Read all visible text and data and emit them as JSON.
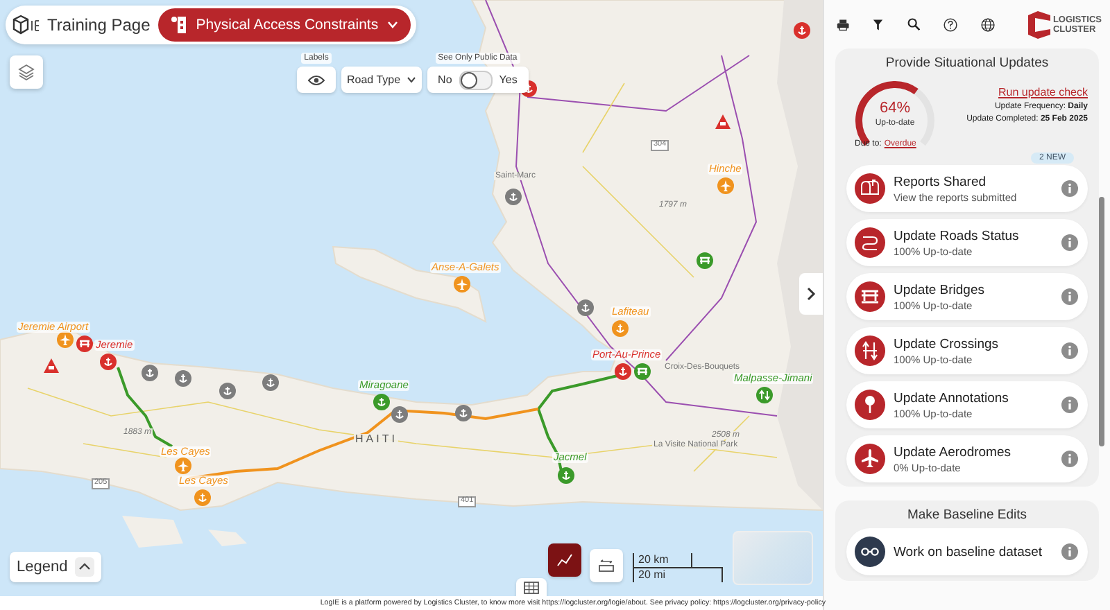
{
  "header": {
    "page_title": "Training Page",
    "layer_button": "Physical Access Constraints"
  },
  "map_controls": {
    "labels_caption": "Labels",
    "road_type": "Road Type",
    "public_data": {
      "caption": "See Only Public Data",
      "off_label": "No",
      "on_label": "Yes",
      "on": false
    }
  },
  "map_labels": [
    {
      "text": "HAITI",
      "kind": "country"
    },
    {
      "text": "Saint-Marc",
      "kind": "place"
    },
    {
      "text": "Croix-Des-Bouquets",
      "kind": "place"
    },
    {
      "text": "La Visite National Park",
      "kind": "place"
    },
    {
      "text": "1883 m",
      "kind": "elevation"
    },
    {
      "text": "1797 m",
      "kind": "elevation"
    },
    {
      "text": "2508 m",
      "kind": "elevation"
    },
    {
      "text": "401",
      "kind": "road"
    },
    {
      "text": "205",
      "kind": "road"
    },
    {
      "text": "304",
      "kind": "road"
    }
  ],
  "markers": [
    {
      "label": "Jeremie Airport",
      "kind": "airport",
      "color": "#f0931e"
    },
    {
      "kind": "bridge",
      "color": "#d9302c"
    },
    {
      "label": "Jeremie",
      "kind": "crossing",
      "color": "#d9302c"
    },
    {
      "kind": "annotation",
      "color": "#d9302c"
    },
    {
      "kind": "crossing",
      "color": "#7d7d7d"
    },
    {
      "kind": "crossing",
      "color": "#7d7d7d"
    },
    {
      "kind": "crossing",
      "color": "#7d7d7d"
    },
    {
      "kind": "crossing",
      "color": "#7d7d7d"
    },
    {
      "label": "Miragoane",
      "kind": "crossing",
      "color": "#3b9a2a"
    },
    {
      "kind": "crossing",
      "color": "#7d7d7d"
    },
    {
      "kind": "crossing",
      "color": "#7d7d7d"
    },
    {
      "label": "Les Cayes",
      "kind": "airport",
      "color": "#f0931e"
    },
    {
      "label": "Les Cayes",
      "kind": "crossing",
      "color": "#f0931e"
    },
    {
      "label": "Jacmel",
      "kind": "crossing",
      "color": "#3b9a2a"
    },
    {
      "label": "Port-Au-Prince",
      "kind": "crossing",
      "color": "#d9302c"
    },
    {
      "kind": "bridge",
      "color": "#3b9a2a"
    },
    {
      "label": "Malpasse-Jimani",
      "kind": "border",
      "color": "#3b9a2a"
    },
    {
      "label": "Anse-A-Galets",
      "kind": "airport",
      "color": "#f0931e"
    },
    {
      "kind": "crossing",
      "color": "#7d7d7d"
    },
    {
      "kind": "crossing",
      "color": "#7d7d7d"
    },
    {
      "label": "Lafiteau",
      "kind": "crossing",
      "color": "#f0931e"
    },
    {
      "label": "Hinche",
      "kind": "airport",
      "color": "#f0931e"
    },
    {
      "kind": "bridge",
      "color": "#3b9a2a"
    },
    {
      "kind": "annotation",
      "color": "#d9302c"
    },
    {
      "kind": "crossing",
      "color": "#d9302c"
    },
    {
      "kind": "crossing",
      "color": "#d9302c"
    }
  ],
  "bottom_tools": {
    "legend": "Legend",
    "buttons": [
      {
        "kind": "chart",
        "selected": true
      },
      {
        "kind": "measure",
        "selected": false
      },
      {
        "kind": "table",
        "selected": false
      }
    ],
    "scale_km": "20 km",
    "scale_mi": "20 mi"
  },
  "footer": "LogIE is a platform powered by Logistics Cluster, to know more visit https://logcluster.org/logie/about. See privacy policy: https://logcluster.org/privacy-policy",
  "panel": {
    "logo_line1": "LOGISTICS",
    "logo_line2": "CLUSTER",
    "updates": {
      "title": "Provide Situational Updates",
      "gauge": {
        "percent": "64%",
        "caption": "Up-to-date",
        "level": 0.64
      },
      "due_label": "Due to:",
      "due_link": "Overdue",
      "run_check": "Run update check",
      "frequency": "Update Frequency: **Daily**",
      "completed": "Update Completed: **25 Feb 2025**",
      "items": [
        {
          "kind": "reports",
          "title": "Reports Shared",
          "subtitle": "View the reports submitted",
          "badge": "2 NEW"
        },
        {
          "kind": "roads",
          "title": "Update Roads Status",
          "subtitle": "100% Up-to-date"
        },
        {
          "kind": "bridges",
          "title": "Update Bridges",
          "subtitle": "100% Up-to-date"
        },
        {
          "kind": "crossings",
          "title": "Update Crossings",
          "subtitle": "100% Up-to-date"
        },
        {
          "kind": "annotations",
          "title": "Update Annotations",
          "subtitle": "100% Up-to-date"
        },
        {
          "kind": "aerodromes",
          "title": "Update Aerodromes",
          "subtitle": "0% Up-to-date"
        }
      ]
    },
    "baseline": {
      "title": "Make Baseline Edits",
      "item": {
        "kind": "baseline",
        "title": "Work on baseline dataset"
      }
    }
  }
}
